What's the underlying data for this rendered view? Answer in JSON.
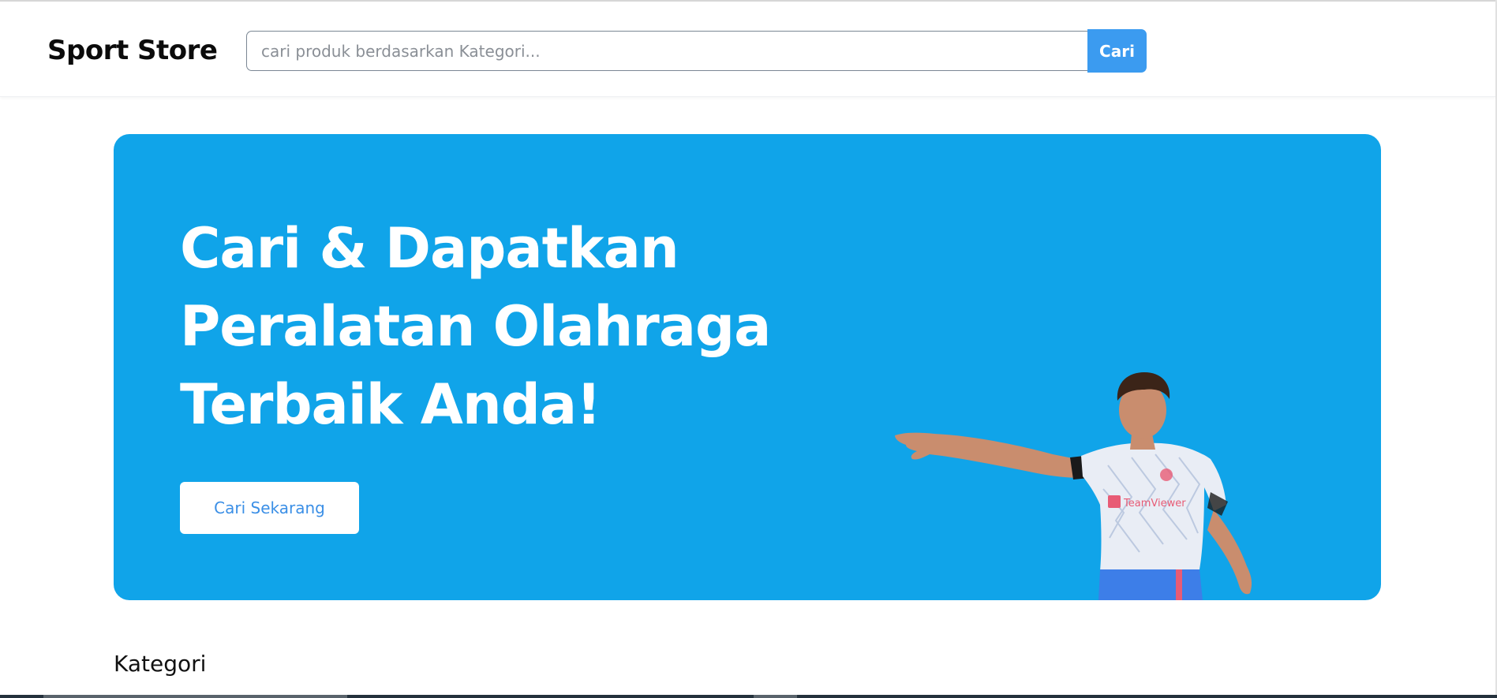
{
  "header": {
    "brand": "Sport Store",
    "search": {
      "placeholder": "cari produk berdasarkan Kategori...",
      "value": "",
      "button_label": "Cari"
    }
  },
  "hero": {
    "title_lines": [
      "Cari & Dapatkan",
      "Peralatan Olahraga",
      "Terbaik Anda!"
    ],
    "cta_label": "Cari Sekarang",
    "background_color": "#10a4e9"
  },
  "sections": {
    "category_title": "Kategori"
  },
  "colors": {
    "accent": "#3b9bf0",
    "hero_bg": "#10a4e9"
  }
}
